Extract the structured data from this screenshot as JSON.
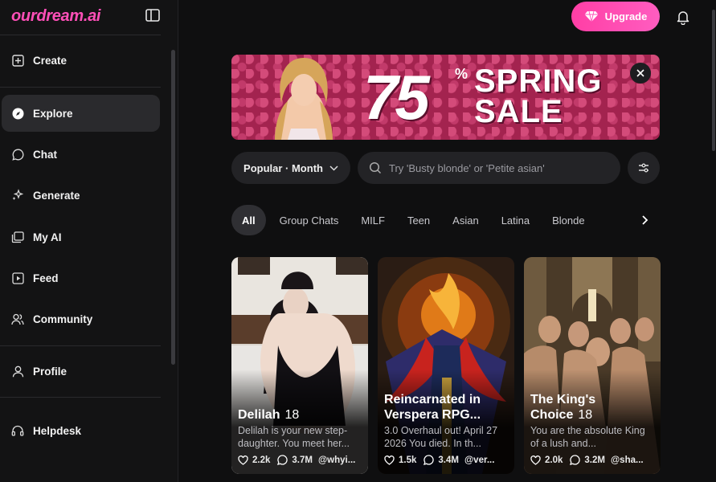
{
  "app": {
    "logo": "ourdream.ai"
  },
  "sidebar": {
    "items": [
      {
        "label": "Create",
        "icon": "plus-square-icon"
      },
      {
        "label": "Explore",
        "icon": "compass-icon",
        "active": true
      },
      {
        "label": "Chat",
        "icon": "chat-bubble-icon"
      },
      {
        "label": "Generate",
        "icon": "sparkles-icon"
      },
      {
        "label": "My AI",
        "icon": "gallery-icon"
      },
      {
        "label": "Feed",
        "icon": "play-square-icon"
      },
      {
        "label": "Community",
        "icon": "users-icon"
      },
      {
        "label": "Profile",
        "icon": "user-icon"
      },
      {
        "label": "Helpdesk",
        "icon": "headset-icon"
      }
    ]
  },
  "header": {
    "upgrade_label": "Upgrade"
  },
  "banner": {
    "discount": "75",
    "percent": "%",
    "line1": "SPRING",
    "line2": "SALE"
  },
  "filters": {
    "sort_label": "Popular · Month",
    "search_placeholder": "Try 'Busty blonde' or 'Petite asian'"
  },
  "categories": [
    "All",
    "Group Chats",
    "MILF",
    "Teen",
    "Asian",
    "Latina",
    "Blonde"
  ],
  "cards": [
    {
      "name": "Delilah",
      "age": "18",
      "description": "Delilah is your new step-daughter. You meet her...",
      "likes": "2.2k",
      "chats": "3.7M",
      "creator": "@whyi..."
    },
    {
      "name": "Reincarnated in Verspera RPG...",
      "age": "",
      "description": "3.0 Overhaul out! April 27 2026 You died. In th...",
      "likes": "1.5k",
      "chats": "3.4M",
      "creator": "@ver..."
    },
    {
      "name": "The King's Choice",
      "age": "18",
      "description": "You are the absolute King of a lush and...",
      "likes": "2.0k",
      "chats": "3.2M",
      "creator": "@sha..."
    }
  ],
  "colors": {
    "accent": "#ff4fb8",
    "background": "#0f0f10",
    "surface": "#232326"
  }
}
